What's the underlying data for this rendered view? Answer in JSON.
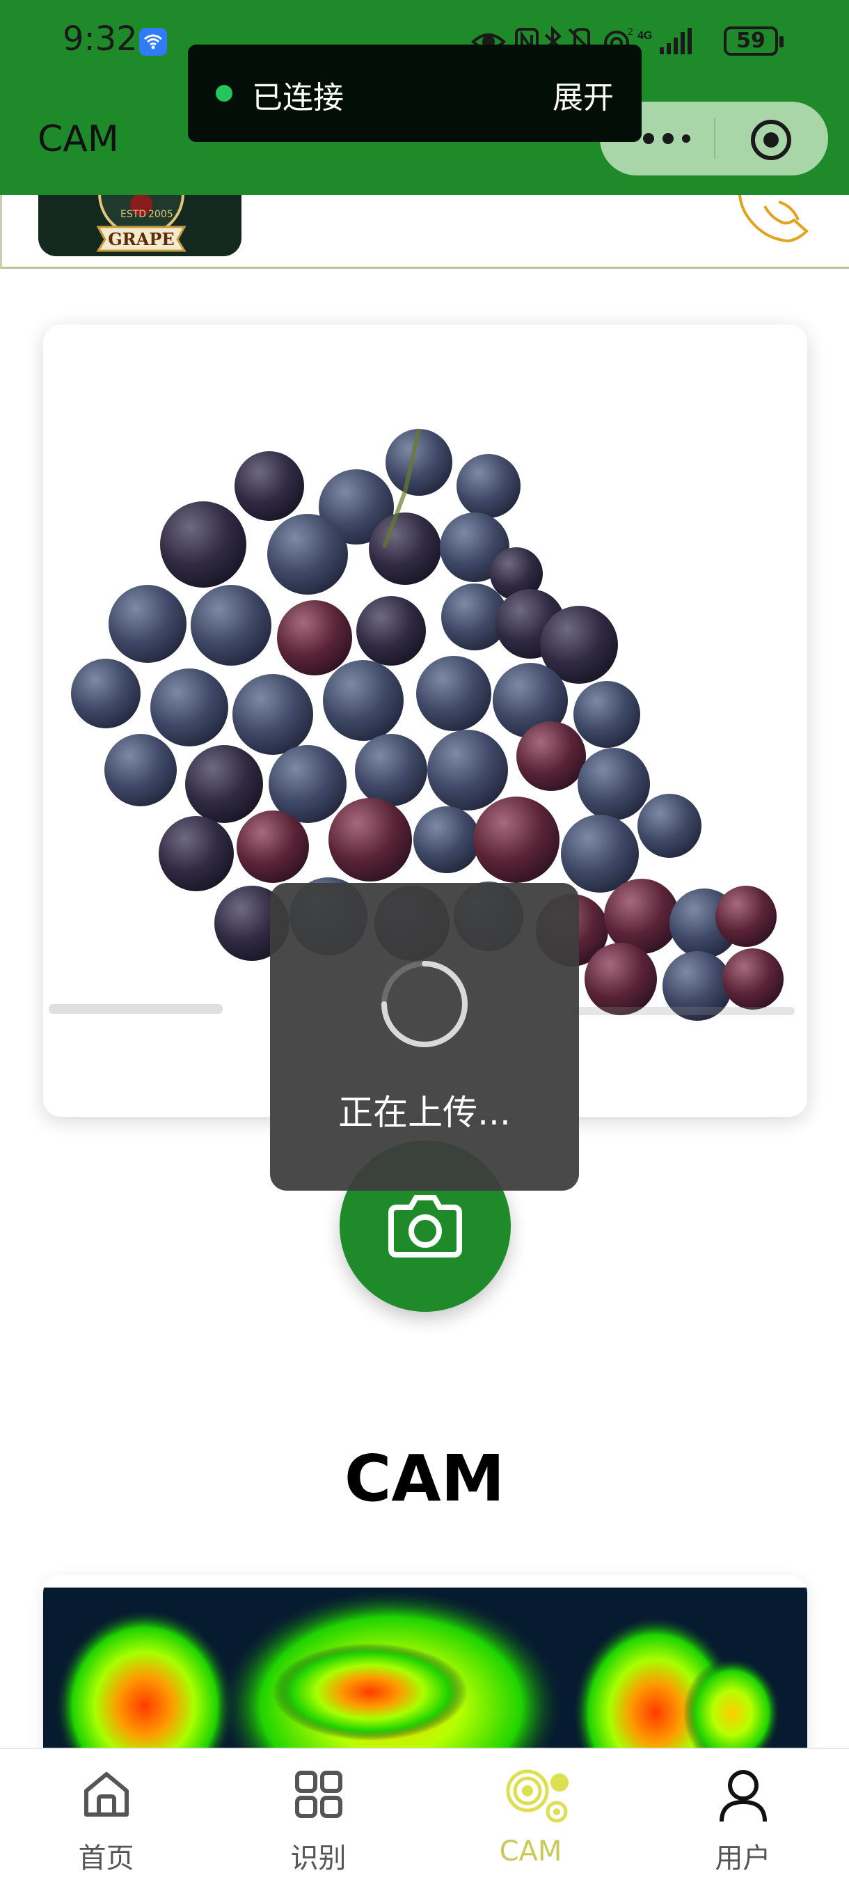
{
  "status_bar": {
    "time": "9:32",
    "battery": "59"
  },
  "header": {
    "title": "CAM"
  },
  "connection_toast": {
    "status": "已连接",
    "expand_label": "展开"
  },
  "brand": {
    "logo_text": "GRAPE"
  },
  "loading": {
    "message": "正在上传..."
  },
  "section": {
    "title": "CAM"
  },
  "tab_bar": {
    "tabs": [
      {
        "label": "首页",
        "icon": "home-icon"
      },
      {
        "label": "识别",
        "icon": "grid-icon"
      },
      {
        "label": "CAM",
        "icon": "cam-icon"
      },
      {
        "label": "用户",
        "icon": "user-icon"
      }
    ],
    "active_index": 2
  },
  "colors": {
    "brand_green": "#1f8a2a",
    "capsule": "#a9d6a9",
    "active_tab": "#c9c95a",
    "toast": "#3e3e3e"
  }
}
